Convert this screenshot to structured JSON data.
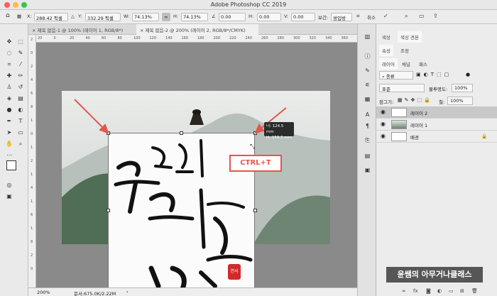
{
  "window": {
    "title": "Adobe Photoshop CC 2019"
  },
  "options_bar": {
    "x_label": "X:",
    "x_value": "288.42 픽셀",
    "y_label": "Y:",
    "y_value": "332.29 픽셀",
    "w_label": "W:",
    "w_value": "74.13%",
    "h_label": "H:",
    "h_value": "74.13%",
    "angle_value": "0.00",
    "h2_label": "H:",
    "h2_value": "0.00",
    "v_label": "V:",
    "v_value": "0.00",
    "interp_label": "보간:",
    "interp_value": "쌍입방",
    "cancel_label": "취소"
  },
  "tabs": [
    {
      "label": "제목 없음-1 @ 100% (레이어 1, RGB/8*)"
    },
    {
      "label": "제목 없음-2 @ 200% (레이어 2, RGB/8*/CMYK)"
    }
  ],
  "ruler_top": [
    "20",
    "0",
    "20",
    "40",
    "60",
    "80",
    "100",
    "120",
    "140",
    "160",
    "180",
    "200",
    "220",
    "240",
    "260",
    "280",
    "300",
    "320",
    "340",
    "360"
  ],
  "ruler_left": [
    "2",
    "0",
    "2",
    "4",
    "6",
    "8",
    "1",
    "0",
    "1",
    "2",
    "1",
    "4",
    "1",
    "6",
    "1",
    "8",
    "2",
    "0"
  ],
  "tooltip": {
    "line1": "너: 124.5 mm",
    "line2": "H: 159.3 mm"
  },
  "ctrl_label": "CTRL+T",
  "seal_text": "연서",
  "status": {
    "zoom": "200%",
    "doc": "문서:675.0K/2.22M"
  },
  "right_panel": {
    "top_tabs": [
      "색상",
      "색상 견본"
    ],
    "prop_tabs": [
      "속성",
      "조정"
    ],
    "layer_tabs": [
      "레이어",
      "채널",
      "패스"
    ],
    "kind_label": "종류",
    "blend_mode": "표준",
    "opacity_label": "불투명도:",
    "opacity_value": "100%",
    "lock_label": "잠그기:",
    "fill_label": "칠:",
    "fill_value": "100%",
    "layers": [
      {
        "name": "레이어 2"
      },
      {
        "name": "레이어 1"
      },
      {
        "name": "배경"
      }
    ]
  },
  "watermark": "윤쌤의 아무거나클래스",
  "colors": {
    "accent": "#e1584a"
  }
}
